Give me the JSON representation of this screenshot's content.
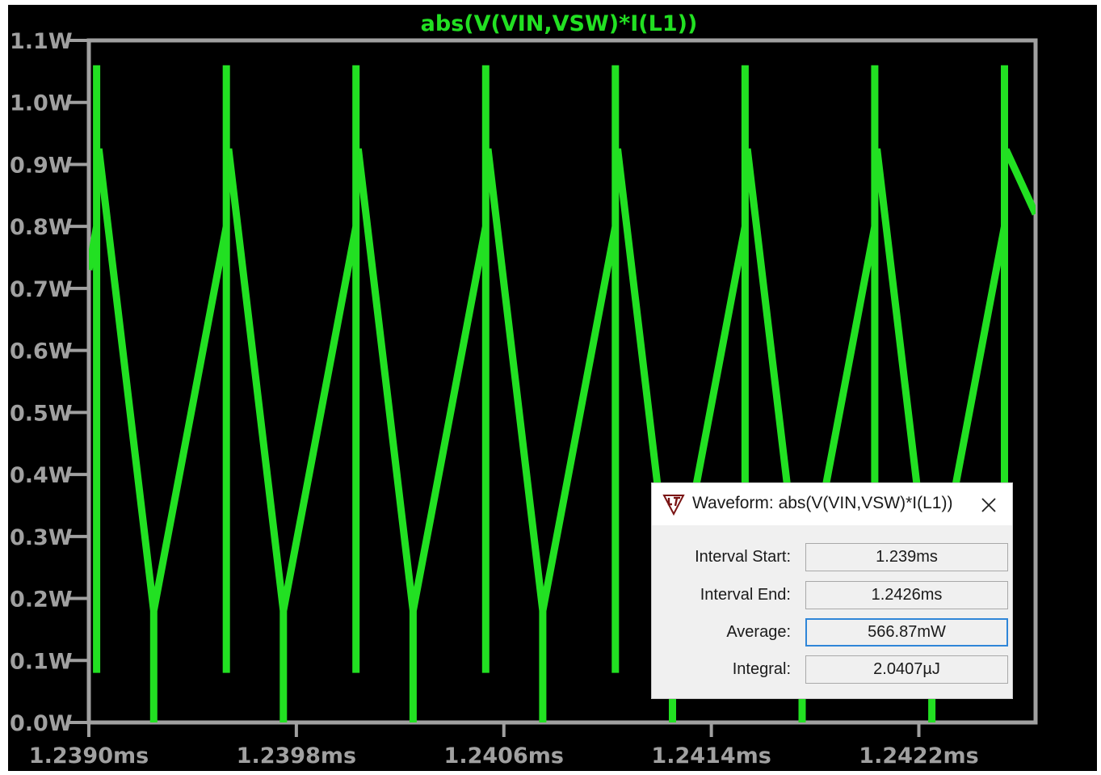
{
  "chart_data": {
    "type": "line",
    "title": "abs(V(VIN,VSW)*I(L1))",
    "xlabel": "",
    "ylabel": "",
    "x_unit": "ms",
    "xlim": [
      1.239,
      1.24265
    ],
    "ylim": [
      0.0,
      1.1
    ],
    "x_tick_labels": [
      "1.2390ms",
      "1.2398ms",
      "1.2406ms",
      "1.2414ms",
      "1.2422ms"
    ],
    "x_ticks": [
      1.239,
      1.2398,
      1.2406,
      1.2414,
      1.2422
    ],
    "y_tick_labels": [
      "0.0W",
      "0.1W",
      "0.2W",
      "0.3W",
      "0.4W",
      "0.5W",
      "0.6W",
      "0.7W",
      "0.8W",
      "0.9W",
      "1.0W",
      "1.1W"
    ],
    "y_ticks": [
      0.0,
      0.1,
      0.2,
      0.3,
      0.4,
      0.5,
      0.6,
      0.7,
      0.8,
      0.9,
      1.0,
      1.1
    ],
    "grid": false,
    "series": [
      {
        "name": "abs(V(VIN,VSW)*I(L1))",
        "color": "#22e022",
        "x": [
          1.239,
          1.23903,
          1.23903,
          1.23903,
          1.23903,
          1.23904,
          1.23925,
          1.23925,
          1.23925,
          1.23925,
          1.23953,
          1.23953,
          1.23953,
          1.23953,
          1.23954,
          1.23975,
          1.23975,
          1.23975,
          1.23975,
          1.24003,
          1.24003,
          1.24003,
          1.24003,
          1.24004,
          1.24025,
          1.24025,
          1.24025,
          1.24025,
          1.24053,
          1.24053,
          1.24053,
          1.24053,
          1.24054,
          1.24075,
          1.24075,
          1.24075,
          1.24075,
          1.24103,
          1.24103,
          1.24103,
          1.24103,
          1.24104,
          1.24125,
          1.24125,
          1.24125,
          1.24125,
          1.24153,
          1.24153,
          1.24153,
          1.24153,
          1.24154,
          1.24175,
          1.24175,
          1.24175,
          1.24175,
          1.24203,
          1.24203,
          1.24203,
          1.24203,
          1.24204,
          1.24225,
          1.24225,
          1.24225,
          1.24225,
          1.24253,
          1.24253,
          1.24253,
          1.24253,
          1.24254,
          1.24265
        ],
        "y": [
          0.73,
          0.8,
          0.08,
          1.06,
          0.92,
          0.92,
          0.18,
          0.0,
          0.0,
          0.18,
          0.8,
          0.08,
          1.06,
          0.92,
          0.92,
          0.18,
          0.0,
          0.0,
          0.18,
          0.8,
          0.08,
          1.06,
          0.92,
          0.92,
          0.18,
          0.0,
          0.0,
          0.18,
          0.8,
          0.08,
          1.06,
          0.92,
          0.92,
          0.18,
          0.0,
          0.0,
          0.18,
          0.8,
          0.08,
          1.06,
          0.92,
          0.92,
          0.18,
          0.0,
          0.0,
          0.18,
          0.8,
          0.08,
          1.06,
          0.92,
          0.92,
          0.18,
          0.0,
          0.0,
          0.18,
          0.8,
          0.08,
          1.06,
          0.92,
          0.92,
          0.18,
          0.0,
          0.0,
          0.18,
          0.8,
          0.08,
          1.06,
          0.92,
          0.92,
          0.82
        ]
      }
    ]
  },
  "dialog": {
    "title": "Waveform: abs(V(VIN,VSW)*I(L1))",
    "app_icon": "ltspice-logo-icon",
    "close_icon": "close-icon",
    "fields": [
      {
        "label": "Interval Start:",
        "value": "1.239ms"
      },
      {
        "label": "Interval End:",
        "value": "1.2426ms"
      },
      {
        "label": "Average:",
        "value": "566.87mW"
      },
      {
        "label": "Integral:",
        "value": "2.0407µJ"
      }
    ],
    "active_field": 2
  }
}
